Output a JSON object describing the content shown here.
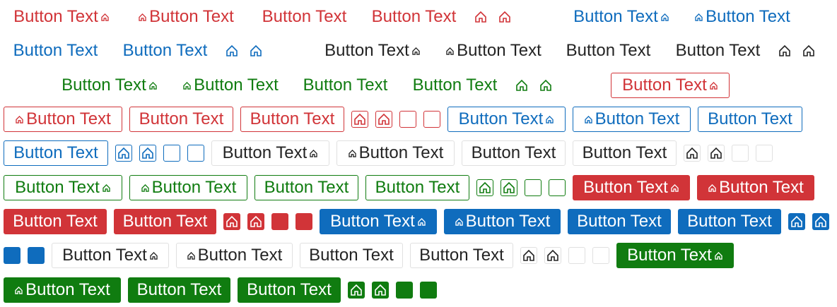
{
  "button_label": "Button Text",
  "icon": "home-icon",
  "colors": {
    "red": "#d13438",
    "blue": "#0f6cbd",
    "dark": "#242424",
    "green": "#107c10"
  }
}
